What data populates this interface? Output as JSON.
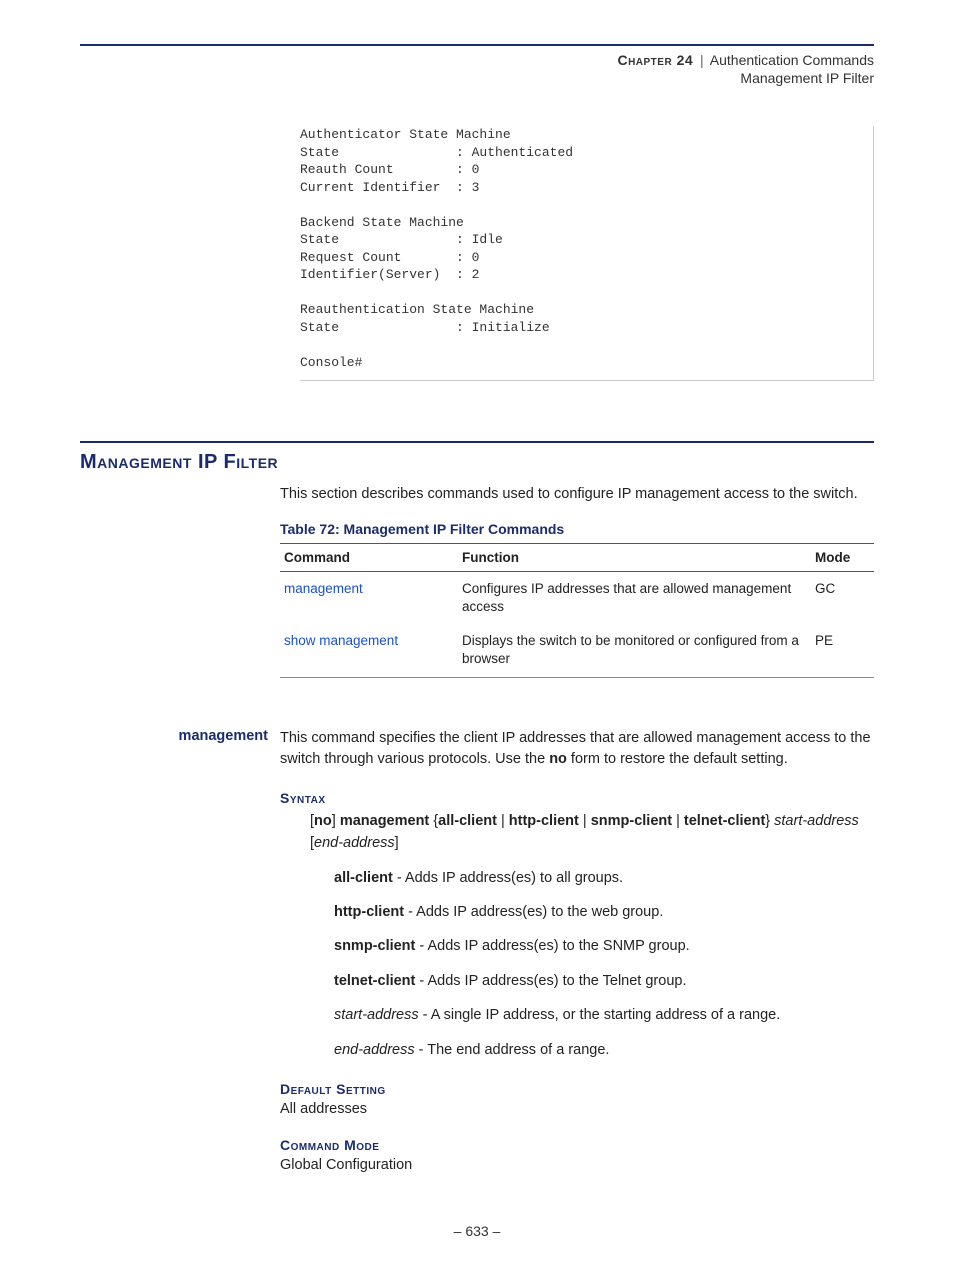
{
  "header": {
    "chapter_label": "Chapter 24",
    "separator": "|",
    "chapter_topic": "Authentication Commands",
    "subtopic": "Management IP Filter"
  },
  "console_output": "Authenticator State Machine\nState               : Authenticated\nReauth Count        : 0\nCurrent Identifier  : 3\n\nBackend State Machine\nState               : Idle\nRequest Count       : 0\nIdentifier(Server)  : 2\n\nReauthentication State Machine\nState               : Initialize\n\nConsole#",
  "section": {
    "title": "Management IP Filter",
    "intro": "This section describes commands used to configure IP management access to the switch."
  },
  "table": {
    "caption": "Table 72: Management IP Filter Commands",
    "headers": {
      "c1": "Command",
      "c2": "Function",
      "c3": "Mode"
    },
    "rows": [
      {
        "cmd": "management",
        "func": "Configures IP addresses that are allowed management access",
        "mode": "GC"
      },
      {
        "cmd": "show management",
        "func": "Displays the switch to be monitored or configured from a browser",
        "mode": "PE"
      }
    ]
  },
  "command": {
    "name": "management",
    "desc_pre": "This command specifies the client IP addresses that are allowed management access to the switch through various protocols. Use the ",
    "desc_bold": "no",
    "desc_post": " form to restore the default setting.",
    "syntax_label": "Syntax",
    "syntax": {
      "p1": "[",
      "p2": "no",
      "p3": "] ",
      "p4": "management",
      "p5": " {",
      "p6": "all-client",
      "p7": " | ",
      "p8": "http-client",
      "p9": " | ",
      "p10": "snmp-client",
      "p11": " | ",
      "p12": "telnet-client",
      "p13": "} ",
      "p14": "start-address",
      "p15": " [",
      "p16": "end-address",
      "p17": "]"
    },
    "options": [
      {
        "name": "all-client",
        "desc": " - Adds IP address(es) to all groups.",
        "bold": true
      },
      {
        "name": "http-client",
        "desc": " - Adds IP address(es) to the web group.",
        "bold": true
      },
      {
        "name": "snmp-client",
        "desc": " - Adds IP address(es) to the SNMP group.",
        "bold": true
      },
      {
        "name": "telnet-client",
        "desc": " - Adds IP address(es) to the Telnet group.",
        "bold": true
      },
      {
        "name": "start-address",
        "desc": " - A single IP address, or the starting address of a range.",
        "bold": false
      },
      {
        "name": "end-address",
        "desc": " - The end address of a range.",
        "bold": false
      }
    ],
    "default_label": "Default Setting",
    "default_value": "All addresses",
    "mode_label": "Command Mode",
    "mode_value": "Global Configuration"
  },
  "page_number": "– 633 –"
}
